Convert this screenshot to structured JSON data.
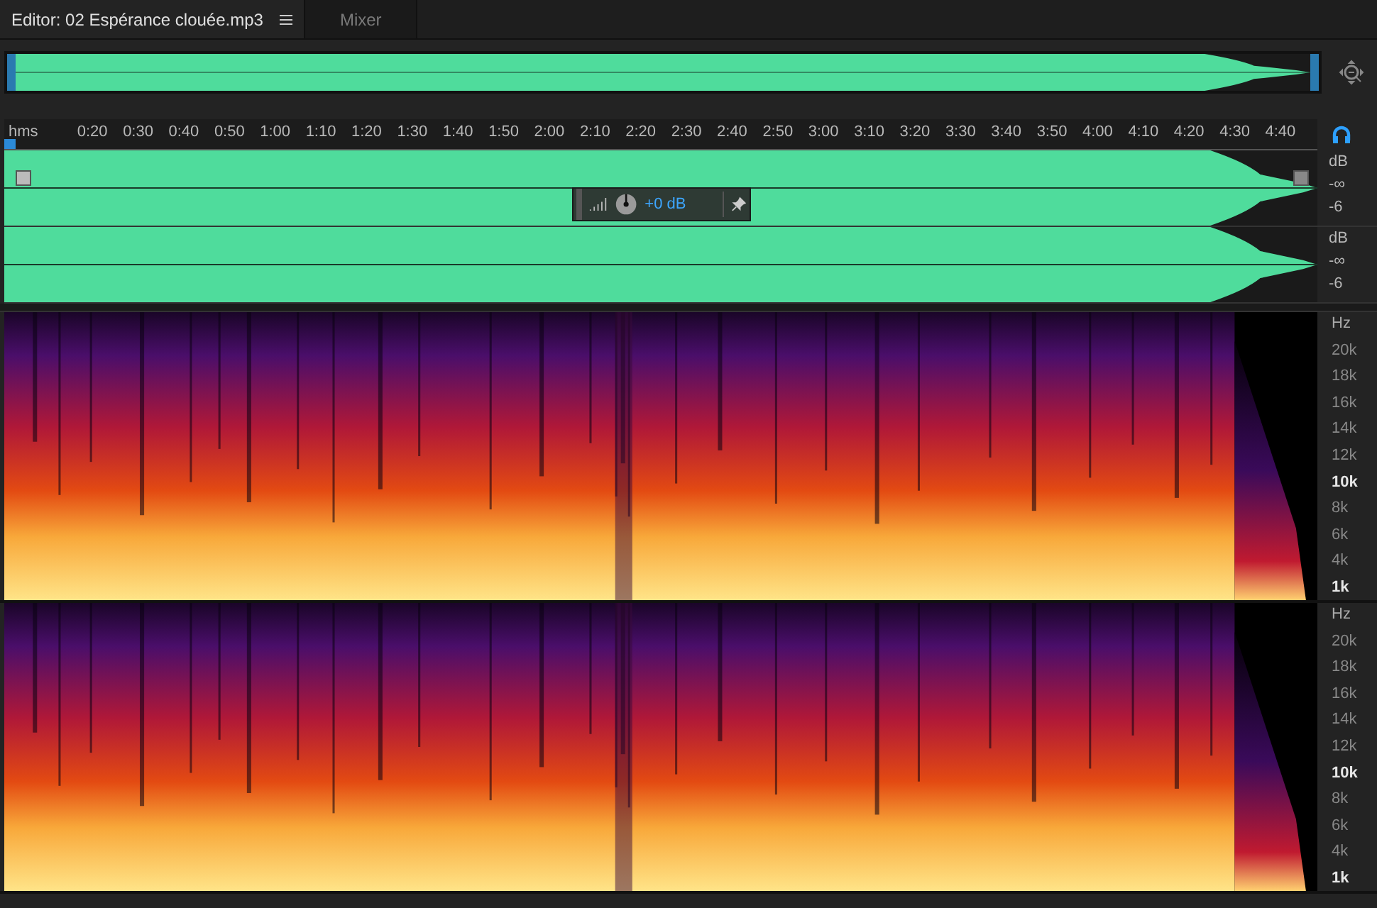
{
  "tabs": [
    {
      "label": "Editor: 02 Espérance clouée.mp3",
      "selected": true,
      "has_menu": true
    },
    {
      "label": "Mixer",
      "selected": false,
      "has_menu": false
    }
  ],
  "ruler": {
    "unit": "hms",
    "labels": [
      "0:20",
      "0:30",
      "0:40",
      "0:50",
      "1:00",
      "1:10",
      "1:20",
      "1:30",
      "1:40",
      "1:50",
      "2:00",
      "2:10",
      "2:20",
      "2:30",
      "2:40",
      "2:50",
      "3:00",
      "3:10",
      "3:20",
      "3:30",
      "3:40",
      "3:50",
      "4:00",
      "4:10",
      "4:20",
      "4:30",
      "4:40"
    ]
  },
  "hud": {
    "gain": "+0 dB"
  },
  "channels": [
    {
      "unit": "dB",
      "marks": [
        "-∞",
        "-6"
      ]
    },
    {
      "unit": "dB",
      "marks": [
        "-∞",
        "-6"
      ]
    }
  ],
  "spectral_channels": [
    {
      "unit": "Hz",
      "labels": [
        {
          "text": "20k",
          "major": false
        },
        {
          "text": "18k",
          "major": false
        },
        {
          "text": "16k",
          "major": false
        },
        {
          "text": "14k",
          "major": false
        },
        {
          "text": "12k",
          "major": false
        },
        {
          "text": "10k",
          "major": true
        },
        {
          "text": "8k",
          "major": false
        },
        {
          "text": "6k",
          "major": false
        },
        {
          "text": "4k",
          "major": false
        },
        {
          "text": "1k",
          "major": true
        }
      ]
    },
    {
      "unit": "Hz",
      "labels": [
        {
          "text": "20k",
          "major": false
        },
        {
          "text": "18k",
          "major": false
        },
        {
          "text": "16k",
          "major": false
        },
        {
          "text": "14k",
          "major": false
        },
        {
          "text": "12k",
          "major": false
        },
        {
          "text": "10k",
          "major": true
        },
        {
          "text": "8k",
          "major": false
        },
        {
          "text": "6k",
          "major": false
        },
        {
          "text": "4k",
          "major": false
        },
        {
          "text": "1k",
          "major": true
        }
      ]
    }
  ]
}
